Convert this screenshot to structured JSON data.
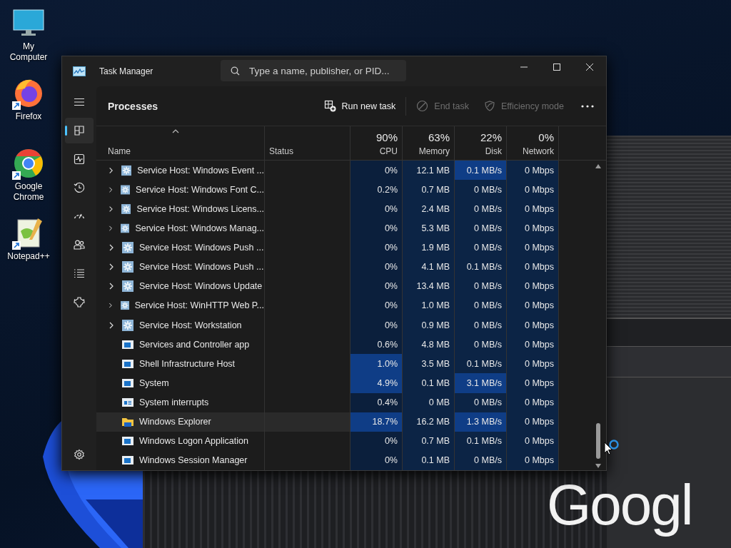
{
  "desktop_icons": [
    {
      "label": "My Computer",
      "kind": "monitor",
      "shortcut": false
    },
    {
      "label": "Firefox",
      "kind": "firefox",
      "shortcut": true
    },
    {
      "label": "Google Chrome",
      "kind": "chrome",
      "shortcut": true
    },
    {
      "label": "Notepad++",
      "kind": "notepad",
      "shortcut": true
    }
  ],
  "background_window": {
    "logo_text": "Googl"
  },
  "window": {
    "title": "Task Manager",
    "search": {
      "placeholder": "Type a name, publisher, or PID..."
    }
  },
  "sidebar": {
    "items": [
      {
        "kind": "menu",
        "selected": false
      },
      {
        "kind": "processes",
        "selected": true
      },
      {
        "kind": "performance",
        "selected": false
      },
      {
        "kind": "history",
        "selected": false
      },
      {
        "kind": "startup",
        "selected": false
      },
      {
        "kind": "users",
        "selected": false
      },
      {
        "kind": "details",
        "selected": false
      },
      {
        "kind": "services",
        "selected": false
      }
    ],
    "footer": [
      {
        "kind": "settings",
        "selected": false
      }
    ]
  },
  "page": {
    "title": "Processes",
    "actions": [
      {
        "label": "Run new task",
        "kind": "run",
        "disabled": false
      },
      {
        "label": "End task",
        "kind": "end",
        "disabled": true
      },
      {
        "label": "Efficiency mode",
        "kind": "efficiency",
        "disabled": true
      }
    ]
  },
  "table": {
    "columns": [
      {
        "label": "Name",
        "kind": "name"
      },
      {
        "label": "Status",
        "kind": "text"
      },
      {
        "label": "CPU",
        "usage": "90%",
        "kind": "metric"
      },
      {
        "label": "Memory",
        "usage": "63%",
        "kind": "metric"
      },
      {
        "label": "Disk",
        "usage": "22%",
        "kind": "metric"
      },
      {
        "label": "Network",
        "usage": "0%",
        "kind": "metric"
      }
    ],
    "rows": [
      {
        "name": "Service Host: Windows Event ...",
        "kind": "gear",
        "expandable": true,
        "selected": false,
        "cpu": "0%",
        "cpu_high": false,
        "memory": "12.1 MB",
        "disk": "0.1 MB/s",
        "disk_high": true,
        "network": "0 Mbps"
      },
      {
        "name": "Service Host: Windows Font C...",
        "kind": "gear",
        "expandable": true,
        "selected": false,
        "cpu": "0.2%",
        "cpu_high": false,
        "memory": "0.7 MB",
        "disk": "0 MB/s",
        "disk_high": false,
        "network": "0 Mbps"
      },
      {
        "name": "Service Host: Windows Licens...",
        "kind": "gear",
        "expandable": true,
        "selected": false,
        "cpu": "0%",
        "cpu_high": false,
        "memory": "2.4 MB",
        "disk": "0 MB/s",
        "disk_high": false,
        "network": "0 Mbps"
      },
      {
        "name": "Service Host: Windows Manag...",
        "kind": "gear",
        "expandable": true,
        "selected": false,
        "cpu": "0%",
        "cpu_high": false,
        "memory": "5.3 MB",
        "disk": "0 MB/s",
        "disk_high": false,
        "network": "0 Mbps"
      },
      {
        "name": "Service Host: Windows Push ...",
        "kind": "gear",
        "expandable": true,
        "selected": false,
        "cpu": "0%",
        "cpu_high": false,
        "memory": "1.9 MB",
        "disk": "0 MB/s",
        "disk_high": false,
        "network": "0 Mbps"
      },
      {
        "name": "Service Host: Windows Push ...",
        "kind": "gear",
        "expandable": true,
        "selected": false,
        "cpu": "0%",
        "cpu_high": false,
        "memory": "4.1 MB",
        "disk": "0.1 MB/s",
        "disk_high": false,
        "network": "0 Mbps"
      },
      {
        "name": "Service Host: Windows Update",
        "kind": "gear",
        "expandable": true,
        "selected": false,
        "cpu": "0%",
        "cpu_high": false,
        "memory": "13.4 MB",
        "disk": "0 MB/s",
        "disk_high": false,
        "network": "0 Mbps"
      },
      {
        "name": "Service Host: WinHTTP Web P...",
        "kind": "gear",
        "expandable": true,
        "selected": false,
        "cpu": "0%",
        "cpu_high": false,
        "memory": "1.0 MB",
        "disk": "0 MB/s",
        "disk_high": false,
        "network": "0 Mbps"
      },
      {
        "name": "Service Host: Workstation",
        "kind": "gear",
        "expandable": true,
        "selected": false,
        "cpu": "0%",
        "cpu_high": false,
        "memory": "0.9 MB",
        "disk": "0 MB/s",
        "disk_high": false,
        "network": "0 Mbps"
      },
      {
        "name": "Services and Controller app",
        "kind": "app",
        "expandable": false,
        "selected": false,
        "cpu": "0.6%",
        "cpu_high": false,
        "memory": "4.8 MB",
        "disk": "0 MB/s",
        "disk_high": false,
        "network": "0 Mbps"
      },
      {
        "name": "Shell Infrastructure Host",
        "kind": "app",
        "expandable": false,
        "selected": false,
        "cpu": "1.0%",
        "cpu_high": true,
        "memory": "3.5 MB",
        "disk": "0.1 MB/s",
        "disk_high": false,
        "network": "0 Mbps"
      },
      {
        "name": "System",
        "kind": "app",
        "expandable": false,
        "selected": false,
        "cpu": "4.9%",
        "cpu_high": true,
        "memory": "0.1 MB",
        "disk": "3.1 MB/s",
        "disk_high": true,
        "network": "0 Mbps"
      },
      {
        "name": "System interrupts",
        "kind": "interrupts",
        "expandable": false,
        "selected": false,
        "cpu": "0.4%",
        "cpu_high": false,
        "memory": "0 MB",
        "disk": "0 MB/s",
        "disk_high": false,
        "network": "0 Mbps"
      },
      {
        "name": "Windows Explorer",
        "kind": "folder",
        "expandable": false,
        "selected": true,
        "cpu": "18.7%",
        "cpu_high": true,
        "memory": "16.2 MB",
        "disk": "1.3 MB/s",
        "disk_high": true,
        "network": "0 Mbps"
      },
      {
        "name": "Windows Logon Application",
        "kind": "app",
        "expandable": false,
        "selected": false,
        "cpu": "0%",
        "cpu_high": false,
        "memory": "0.7 MB",
        "disk": "0.1 MB/s",
        "disk_high": false,
        "network": "0 Mbps"
      },
      {
        "name": "Windows Session Manager",
        "kind": "app",
        "expandable": false,
        "selected": false,
        "cpu": "0%",
        "cpu_high": false,
        "memory": "0.1 MB",
        "disk": "0 MB/s",
        "disk_high": false,
        "network": "0 Mbps"
      }
    ]
  }
}
